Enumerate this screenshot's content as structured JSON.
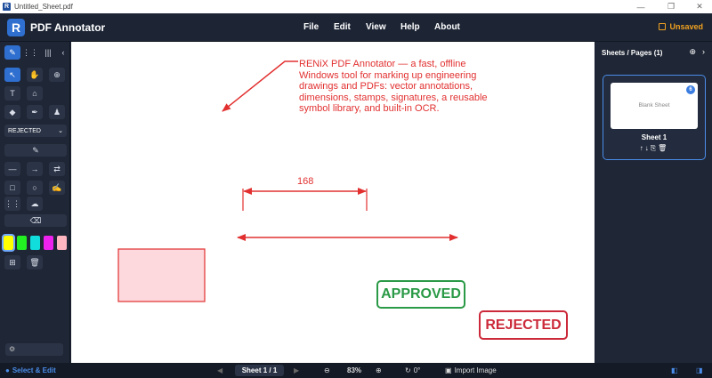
{
  "window": {
    "title": "Untitled_Sheet.pdf"
  },
  "app": {
    "name": "PDF Annotator",
    "logo_letter": "R",
    "save_state": "Unsaved"
  },
  "menu": [
    "File",
    "Edit",
    "View",
    "Help",
    "About"
  ],
  "toolbar": {
    "stamp_select": "REJECTED"
  },
  "swatches": [
    "#ffff00",
    "#22ee22",
    "#11dddd",
    "#ee22ee",
    "#ffb6c1"
  ],
  "canvas": {
    "callout_text": "RENiX PDF Annotator — a fast, offline Windows tool for marking up engineering drawings and PDFs: vector annotations, dimensions, stamps, signatures, a reusable symbol library, and built-in OCR.",
    "dimension_value": "168",
    "stamps": {
      "approved": "APPROVED",
      "rejected": "REJECTED"
    },
    "annotation_color": "#e23030",
    "rect_fill": "#fdd8dc"
  },
  "sidebar": {
    "title": "Sheets / Pages (1)",
    "pages": [
      {
        "label": "Sheet 1",
        "thumb_text": "Blank Sheet",
        "badge": "6"
      }
    ]
  },
  "status": {
    "mode": "Select & Edit",
    "sheet": "Sheet 1 / 1",
    "zoom": "83%",
    "rotation": "0°",
    "import": "Import Image"
  }
}
